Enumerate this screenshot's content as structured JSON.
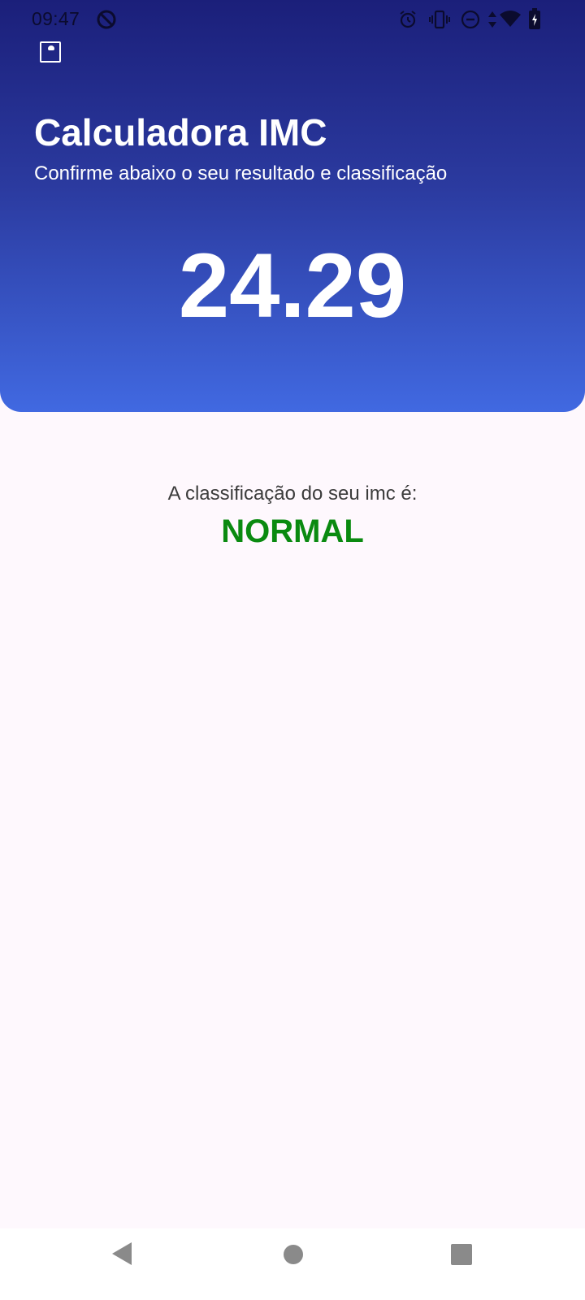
{
  "status_bar": {
    "time": "09:47",
    "icons": [
      "no-disturb-clock-icon",
      "alarm-icon",
      "vibrate-icon",
      "do-not-disturb-icon",
      "data-arrows-icon",
      "wifi-icon",
      "battery-charging-icon"
    ]
  },
  "header": {
    "app_icon": "notification-app-icon",
    "title": "Calculadora IMC",
    "subtitle": "Confirme abaixo o seu resultado e classificação",
    "imc_value": "24.29",
    "gradient_top": "#1B1F7A",
    "gradient_bottom": "#4169E1"
  },
  "result": {
    "label": "A classificação do seu imc é:",
    "classification": "NORMAL",
    "classification_color": "#0A8A10"
  },
  "nav_bar": {
    "buttons": [
      "back-icon",
      "home-icon",
      "recents-icon"
    ]
  }
}
